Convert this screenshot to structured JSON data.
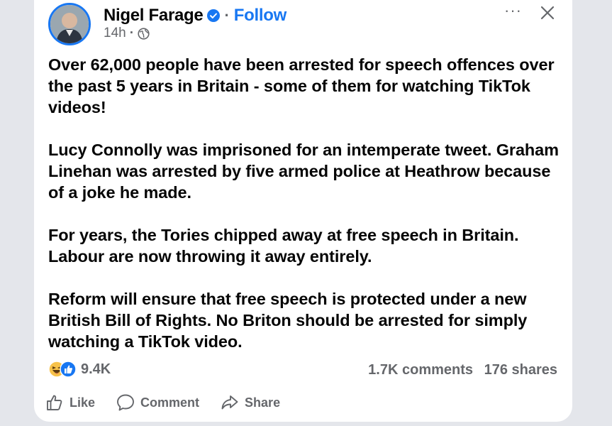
{
  "post": {
    "author": "Nigel Farage",
    "follow_label": "Follow",
    "separator": "·",
    "timestamp": "14h",
    "more_label": "···",
    "paragraphs": [
      "Over 62,000 people have been arrested for speech offences over the past 5 years in Britain - some of them for watching TikTok videos!",
      "Lucy Connolly was imprisoned for an intemperate tweet. Graham Linehan was arrested by five armed police at Heathrow because of a joke he made.",
      "For years, the Tories chipped away at free speech in Britain. Labour are now throwing it away entirely.",
      "Reform will ensure that free speech is protected under a new British Bill of Rights. No Briton should be arrested for simply watching a TikTok video."
    ],
    "reaction_count": "9.4K",
    "comments": "1.7K comments",
    "shares": "176 shares"
  },
  "actions": {
    "like": "Like",
    "comment": "Comment",
    "share": "Share"
  },
  "colors": {
    "accent": "#1877f2",
    "secondary_text": "#65676b",
    "primary_text": "#050505",
    "background": "#e4e6eb"
  },
  "icons": [
    "verified-badge-icon",
    "globe-icon",
    "close-icon",
    "haha-reaction-icon",
    "like-reaction-icon",
    "thumbs-up-icon",
    "comment-bubble-icon",
    "share-arrow-icon"
  ]
}
